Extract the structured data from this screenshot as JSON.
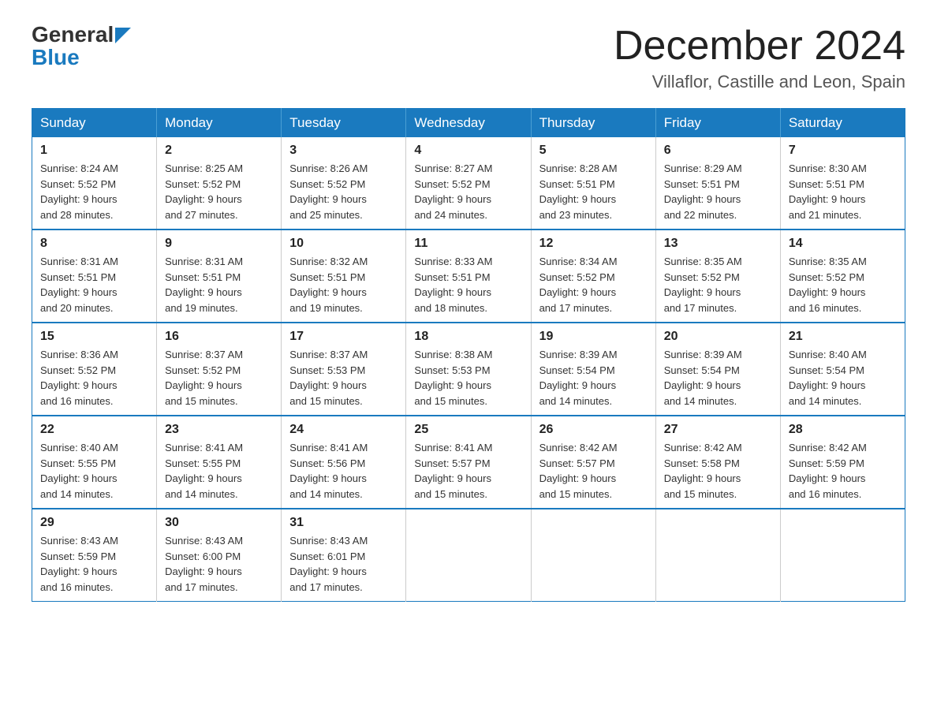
{
  "logo": {
    "general": "General",
    "blue": "Blue",
    "arrow_color": "#1a7abf"
  },
  "header": {
    "month_year": "December 2024",
    "location": "Villaflor, Castille and Leon, Spain"
  },
  "weekdays": [
    "Sunday",
    "Monday",
    "Tuesday",
    "Wednesday",
    "Thursday",
    "Friday",
    "Saturday"
  ],
  "weeks": [
    [
      {
        "day": "1",
        "sunrise": "8:24 AM",
        "sunset": "5:52 PM",
        "daylight": "9 hours and 28 minutes."
      },
      {
        "day": "2",
        "sunrise": "8:25 AM",
        "sunset": "5:52 PM",
        "daylight": "9 hours and 27 minutes."
      },
      {
        "day": "3",
        "sunrise": "8:26 AM",
        "sunset": "5:52 PM",
        "daylight": "9 hours and 25 minutes."
      },
      {
        "day": "4",
        "sunrise": "8:27 AM",
        "sunset": "5:52 PM",
        "daylight": "9 hours and 24 minutes."
      },
      {
        "day": "5",
        "sunrise": "8:28 AM",
        "sunset": "5:51 PM",
        "daylight": "9 hours and 23 minutes."
      },
      {
        "day": "6",
        "sunrise": "8:29 AM",
        "sunset": "5:51 PM",
        "daylight": "9 hours and 22 minutes."
      },
      {
        "day": "7",
        "sunrise": "8:30 AM",
        "sunset": "5:51 PM",
        "daylight": "9 hours and 21 minutes."
      }
    ],
    [
      {
        "day": "8",
        "sunrise": "8:31 AM",
        "sunset": "5:51 PM",
        "daylight": "9 hours and 20 minutes."
      },
      {
        "day": "9",
        "sunrise": "8:31 AM",
        "sunset": "5:51 PM",
        "daylight": "9 hours and 19 minutes."
      },
      {
        "day": "10",
        "sunrise": "8:32 AM",
        "sunset": "5:51 PM",
        "daylight": "9 hours and 19 minutes."
      },
      {
        "day": "11",
        "sunrise": "8:33 AM",
        "sunset": "5:51 PM",
        "daylight": "9 hours and 18 minutes."
      },
      {
        "day": "12",
        "sunrise": "8:34 AM",
        "sunset": "5:52 PM",
        "daylight": "9 hours and 17 minutes."
      },
      {
        "day": "13",
        "sunrise": "8:35 AM",
        "sunset": "5:52 PM",
        "daylight": "9 hours and 17 minutes."
      },
      {
        "day": "14",
        "sunrise": "8:35 AM",
        "sunset": "5:52 PM",
        "daylight": "9 hours and 16 minutes."
      }
    ],
    [
      {
        "day": "15",
        "sunrise": "8:36 AM",
        "sunset": "5:52 PM",
        "daylight": "9 hours and 16 minutes."
      },
      {
        "day": "16",
        "sunrise": "8:37 AM",
        "sunset": "5:52 PM",
        "daylight": "9 hours and 15 minutes."
      },
      {
        "day": "17",
        "sunrise": "8:37 AM",
        "sunset": "5:53 PM",
        "daylight": "9 hours and 15 minutes."
      },
      {
        "day": "18",
        "sunrise": "8:38 AM",
        "sunset": "5:53 PM",
        "daylight": "9 hours and 15 minutes."
      },
      {
        "day": "19",
        "sunrise": "8:39 AM",
        "sunset": "5:54 PM",
        "daylight": "9 hours and 14 minutes."
      },
      {
        "day": "20",
        "sunrise": "8:39 AM",
        "sunset": "5:54 PM",
        "daylight": "9 hours and 14 minutes."
      },
      {
        "day": "21",
        "sunrise": "8:40 AM",
        "sunset": "5:54 PM",
        "daylight": "9 hours and 14 minutes."
      }
    ],
    [
      {
        "day": "22",
        "sunrise": "8:40 AM",
        "sunset": "5:55 PM",
        "daylight": "9 hours and 14 minutes."
      },
      {
        "day": "23",
        "sunrise": "8:41 AM",
        "sunset": "5:55 PM",
        "daylight": "9 hours and 14 minutes."
      },
      {
        "day": "24",
        "sunrise": "8:41 AM",
        "sunset": "5:56 PM",
        "daylight": "9 hours and 14 minutes."
      },
      {
        "day": "25",
        "sunrise": "8:41 AM",
        "sunset": "5:57 PM",
        "daylight": "9 hours and 15 minutes."
      },
      {
        "day": "26",
        "sunrise": "8:42 AM",
        "sunset": "5:57 PM",
        "daylight": "9 hours and 15 minutes."
      },
      {
        "day": "27",
        "sunrise": "8:42 AM",
        "sunset": "5:58 PM",
        "daylight": "9 hours and 15 minutes."
      },
      {
        "day": "28",
        "sunrise": "8:42 AM",
        "sunset": "5:59 PM",
        "daylight": "9 hours and 16 minutes."
      }
    ],
    [
      {
        "day": "29",
        "sunrise": "8:43 AM",
        "sunset": "5:59 PM",
        "daylight": "9 hours and 16 minutes."
      },
      {
        "day": "30",
        "sunrise": "8:43 AM",
        "sunset": "6:00 PM",
        "daylight": "9 hours and 17 minutes."
      },
      {
        "day": "31",
        "sunrise": "8:43 AM",
        "sunset": "6:01 PM",
        "daylight": "9 hours and 17 minutes."
      },
      null,
      null,
      null,
      null
    ]
  ],
  "labels": {
    "sunrise": "Sunrise:",
    "sunset": "Sunset:",
    "daylight": "Daylight:"
  }
}
